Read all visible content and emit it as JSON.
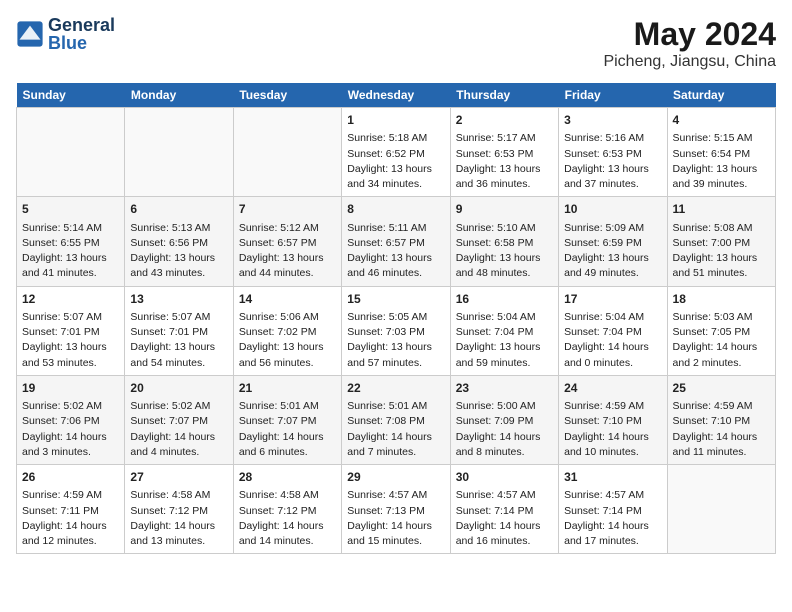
{
  "header": {
    "logo_line1": "General",
    "logo_line2": "Blue",
    "title": "May 2024",
    "subtitle": "Picheng, Jiangsu, China"
  },
  "days_of_week": [
    "Sunday",
    "Monday",
    "Tuesday",
    "Wednesday",
    "Thursday",
    "Friday",
    "Saturday"
  ],
  "weeks": [
    [
      {
        "day": "",
        "data": ""
      },
      {
        "day": "",
        "data": ""
      },
      {
        "day": "",
        "data": ""
      },
      {
        "day": "1",
        "data": "Sunrise: 5:18 AM\nSunset: 6:52 PM\nDaylight: 13 hours\nand 34 minutes."
      },
      {
        "day": "2",
        "data": "Sunrise: 5:17 AM\nSunset: 6:53 PM\nDaylight: 13 hours\nand 36 minutes."
      },
      {
        "day": "3",
        "data": "Sunrise: 5:16 AM\nSunset: 6:53 PM\nDaylight: 13 hours\nand 37 minutes."
      },
      {
        "day": "4",
        "data": "Sunrise: 5:15 AM\nSunset: 6:54 PM\nDaylight: 13 hours\nand 39 minutes."
      }
    ],
    [
      {
        "day": "5",
        "data": "Sunrise: 5:14 AM\nSunset: 6:55 PM\nDaylight: 13 hours\nand 41 minutes."
      },
      {
        "day": "6",
        "data": "Sunrise: 5:13 AM\nSunset: 6:56 PM\nDaylight: 13 hours\nand 43 minutes."
      },
      {
        "day": "7",
        "data": "Sunrise: 5:12 AM\nSunset: 6:57 PM\nDaylight: 13 hours\nand 44 minutes."
      },
      {
        "day": "8",
        "data": "Sunrise: 5:11 AM\nSunset: 6:57 PM\nDaylight: 13 hours\nand 46 minutes."
      },
      {
        "day": "9",
        "data": "Sunrise: 5:10 AM\nSunset: 6:58 PM\nDaylight: 13 hours\nand 48 minutes."
      },
      {
        "day": "10",
        "data": "Sunrise: 5:09 AM\nSunset: 6:59 PM\nDaylight: 13 hours\nand 49 minutes."
      },
      {
        "day": "11",
        "data": "Sunrise: 5:08 AM\nSunset: 7:00 PM\nDaylight: 13 hours\nand 51 minutes."
      }
    ],
    [
      {
        "day": "12",
        "data": "Sunrise: 5:07 AM\nSunset: 7:01 PM\nDaylight: 13 hours\nand 53 minutes."
      },
      {
        "day": "13",
        "data": "Sunrise: 5:07 AM\nSunset: 7:01 PM\nDaylight: 13 hours\nand 54 minutes."
      },
      {
        "day": "14",
        "data": "Sunrise: 5:06 AM\nSunset: 7:02 PM\nDaylight: 13 hours\nand 56 minutes."
      },
      {
        "day": "15",
        "data": "Sunrise: 5:05 AM\nSunset: 7:03 PM\nDaylight: 13 hours\nand 57 minutes."
      },
      {
        "day": "16",
        "data": "Sunrise: 5:04 AM\nSunset: 7:04 PM\nDaylight: 13 hours\nand 59 minutes."
      },
      {
        "day": "17",
        "data": "Sunrise: 5:04 AM\nSunset: 7:04 PM\nDaylight: 14 hours\nand 0 minutes."
      },
      {
        "day": "18",
        "data": "Sunrise: 5:03 AM\nSunset: 7:05 PM\nDaylight: 14 hours\nand 2 minutes."
      }
    ],
    [
      {
        "day": "19",
        "data": "Sunrise: 5:02 AM\nSunset: 7:06 PM\nDaylight: 14 hours\nand 3 minutes."
      },
      {
        "day": "20",
        "data": "Sunrise: 5:02 AM\nSunset: 7:07 PM\nDaylight: 14 hours\nand 4 minutes."
      },
      {
        "day": "21",
        "data": "Sunrise: 5:01 AM\nSunset: 7:07 PM\nDaylight: 14 hours\nand 6 minutes."
      },
      {
        "day": "22",
        "data": "Sunrise: 5:01 AM\nSunset: 7:08 PM\nDaylight: 14 hours\nand 7 minutes."
      },
      {
        "day": "23",
        "data": "Sunrise: 5:00 AM\nSunset: 7:09 PM\nDaylight: 14 hours\nand 8 minutes."
      },
      {
        "day": "24",
        "data": "Sunrise: 4:59 AM\nSunset: 7:10 PM\nDaylight: 14 hours\nand 10 minutes."
      },
      {
        "day": "25",
        "data": "Sunrise: 4:59 AM\nSunset: 7:10 PM\nDaylight: 14 hours\nand 11 minutes."
      }
    ],
    [
      {
        "day": "26",
        "data": "Sunrise: 4:59 AM\nSunset: 7:11 PM\nDaylight: 14 hours\nand 12 minutes."
      },
      {
        "day": "27",
        "data": "Sunrise: 4:58 AM\nSunset: 7:12 PM\nDaylight: 14 hours\nand 13 minutes."
      },
      {
        "day": "28",
        "data": "Sunrise: 4:58 AM\nSunset: 7:12 PM\nDaylight: 14 hours\nand 14 minutes."
      },
      {
        "day": "29",
        "data": "Sunrise: 4:57 AM\nSunset: 7:13 PM\nDaylight: 14 hours\nand 15 minutes."
      },
      {
        "day": "30",
        "data": "Sunrise: 4:57 AM\nSunset: 7:14 PM\nDaylight: 14 hours\nand 16 minutes."
      },
      {
        "day": "31",
        "data": "Sunrise: 4:57 AM\nSunset: 7:14 PM\nDaylight: 14 hours\nand 17 minutes."
      },
      {
        "day": "",
        "data": ""
      }
    ]
  ]
}
